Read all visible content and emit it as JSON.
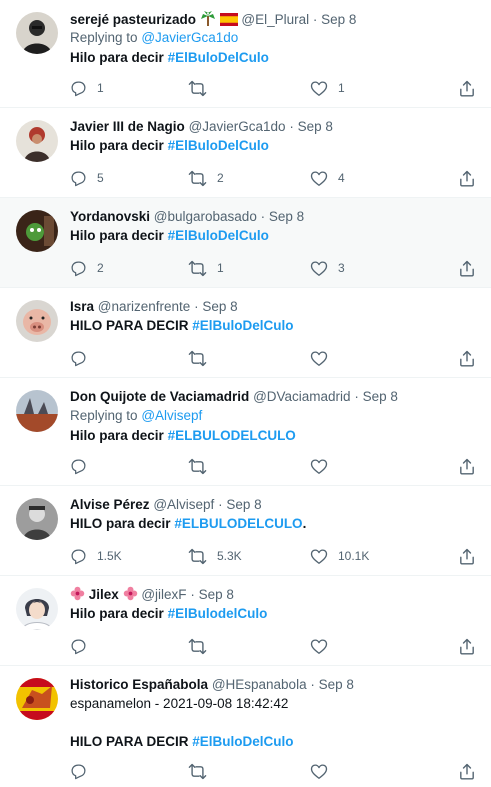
{
  "tweets": [
    {
      "name": "serejé pasteurizado",
      "handle": "@El_Plural",
      "date": "Sep 8",
      "replying_label": "Replying to",
      "replying_to": "@JavierGca1do",
      "body_prefix": "Hilo para decir",
      "hashtag": "#ElBuloDelCulo",
      "body_suffix": "",
      "counts": {
        "reply": "1",
        "retweet": "",
        "like": "1"
      },
      "name_emoji": [
        "palm-tree",
        "spain-flag"
      ]
    },
    {
      "name": "Javier III de Nagio",
      "handle": "@JavierGca1do",
      "date": "Sep 8",
      "body_prefix": "Hilo para decir",
      "hashtag": "#ElBuloDelCulo",
      "body_suffix": "",
      "counts": {
        "reply": "5",
        "retweet": "2",
        "like": "4"
      }
    },
    {
      "name": "Yordanovski",
      "handle": "@bulgarobasado",
      "date": "Sep 8",
      "body_prefix": "Hilo para decir",
      "hashtag": "#ElBuloDelCulo",
      "body_suffix": "",
      "counts": {
        "reply": "2",
        "retweet": "1",
        "like": "3"
      }
    },
    {
      "name": "Isra",
      "handle": "@narizenfrente",
      "date": "Sep 8",
      "body_prefix": "HILO PARA DECIR",
      "hashtag": "#ElBuloDelCulo",
      "body_suffix": "",
      "counts": {
        "reply": "",
        "retweet": "",
        "like": ""
      }
    },
    {
      "name": "Don Quijote de Vaciamadrid",
      "handle": "@DVaciamadrid",
      "date": "Sep 8",
      "replying_label": "Replying to",
      "replying_to": "@Alvisepf",
      "body_prefix": "Hilo para decir",
      "hashtag": "#ELBULODELCULO",
      "body_suffix": "",
      "counts": {
        "reply": "",
        "retweet": "",
        "like": ""
      }
    },
    {
      "name": "Alvise Pérez",
      "handle": "@Alvisepf",
      "date": "Sep 8",
      "body_prefix": "HILO para decir",
      "hashtag": "#ELBULODELCULO",
      "body_suffix": ".",
      "counts": {
        "reply": "1.5K",
        "retweet": "5.3K",
        "like": "10.1K"
      }
    },
    {
      "name": "Jilex",
      "handle": "@jilexF",
      "date": "Sep 8",
      "body_prefix": "Hilo para decir",
      "hashtag": "#ElBulodelCulo",
      "body_suffix": "",
      "counts": {
        "reply": "",
        "retweet": "",
        "like": ""
      },
      "name_emoji": [
        "hibiscus",
        "hibiscus"
      ]
    },
    {
      "name": "Historico Españabola",
      "handle": "@HEspanabola",
      "date": "Sep 8",
      "extra_line": "espanamelon - 2021-09-08 18:42:42",
      "body_prefix": "HILO PARA DECIR",
      "hashtag": "#ElBuloDelCulo",
      "body_suffix": "",
      "counts": {
        "reply": "",
        "retweet": "",
        "like": ""
      }
    }
  ],
  "icons": {
    "reply": "reply-icon",
    "retweet": "retweet-icon",
    "like": "heart-icon",
    "share": "share-icon"
  },
  "colors": {
    "link": "#1d9bf0",
    "muted": "#536471",
    "text": "#0f1419",
    "highlight_row": "#f7f9f9"
  }
}
